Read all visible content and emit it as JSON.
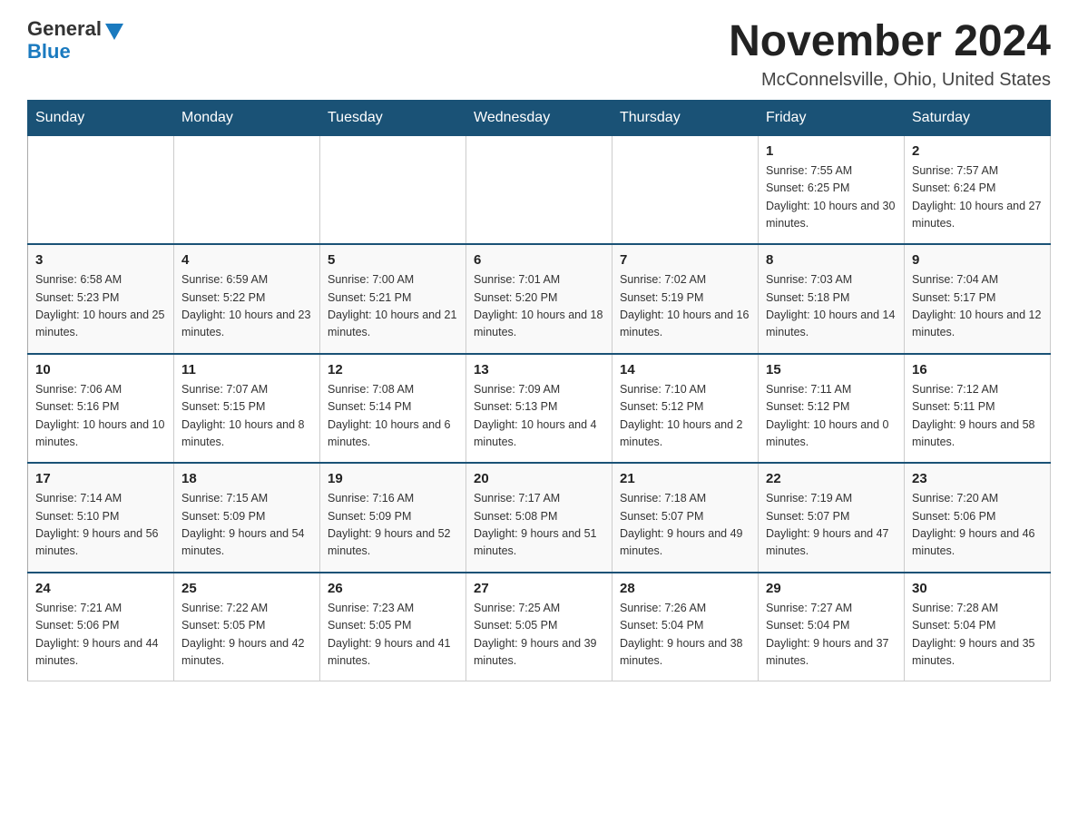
{
  "logo": {
    "general": "General",
    "blue": "Blue"
  },
  "title": "November 2024",
  "location": "McConnelsville, Ohio, United States",
  "headers": [
    "Sunday",
    "Monday",
    "Tuesday",
    "Wednesday",
    "Thursday",
    "Friday",
    "Saturday"
  ],
  "weeks": [
    [
      {
        "day": "",
        "sunrise": "",
        "sunset": "",
        "daylight": ""
      },
      {
        "day": "",
        "sunrise": "",
        "sunset": "",
        "daylight": ""
      },
      {
        "day": "",
        "sunrise": "",
        "sunset": "",
        "daylight": ""
      },
      {
        "day": "",
        "sunrise": "",
        "sunset": "",
        "daylight": ""
      },
      {
        "day": "",
        "sunrise": "",
        "sunset": "",
        "daylight": ""
      },
      {
        "day": "1",
        "sunrise": "Sunrise: 7:55 AM",
        "sunset": "Sunset: 6:25 PM",
        "daylight": "Daylight: 10 hours and 30 minutes."
      },
      {
        "day": "2",
        "sunrise": "Sunrise: 7:57 AM",
        "sunset": "Sunset: 6:24 PM",
        "daylight": "Daylight: 10 hours and 27 minutes."
      }
    ],
    [
      {
        "day": "3",
        "sunrise": "Sunrise: 6:58 AM",
        "sunset": "Sunset: 5:23 PM",
        "daylight": "Daylight: 10 hours and 25 minutes."
      },
      {
        "day": "4",
        "sunrise": "Sunrise: 6:59 AM",
        "sunset": "Sunset: 5:22 PM",
        "daylight": "Daylight: 10 hours and 23 minutes."
      },
      {
        "day": "5",
        "sunrise": "Sunrise: 7:00 AM",
        "sunset": "Sunset: 5:21 PM",
        "daylight": "Daylight: 10 hours and 21 minutes."
      },
      {
        "day": "6",
        "sunrise": "Sunrise: 7:01 AM",
        "sunset": "Sunset: 5:20 PM",
        "daylight": "Daylight: 10 hours and 18 minutes."
      },
      {
        "day": "7",
        "sunrise": "Sunrise: 7:02 AM",
        "sunset": "Sunset: 5:19 PM",
        "daylight": "Daylight: 10 hours and 16 minutes."
      },
      {
        "day": "8",
        "sunrise": "Sunrise: 7:03 AM",
        "sunset": "Sunset: 5:18 PM",
        "daylight": "Daylight: 10 hours and 14 minutes."
      },
      {
        "day": "9",
        "sunrise": "Sunrise: 7:04 AM",
        "sunset": "Sunset: 5:17 PM",
        "daylight": "Daylight: 10 hours and 12 minutes."
      }
    ],
    [
      {
        "day": "10",
        "sunrise": "Sunrise: 7:06 AM",
        "sunset": "Sunset: 5:16 PM",
        "daylight": "Daylight: 10 hours and 10 minutes."
      },
      {
        "day": "11",
        "sunrise": "Sunrise: 7:07 AM",
        "sunset": "Sunset: 5:15 PM",
        "daylight": "Daylight: 10 hours and 8 minutes."
      },
      {
        "day": "12",
        "sunrise": "Sunrise: 7:08 AM",
        "sunset": "Sunset: 5:14 PM",
        "daylight": "Daylight: 10 hours and 6 minutes."
      },
      {
        "day": "13",
        "sunrise": "Sunrise: 7:09 AM",
        "sunset": "Sunset: 5:13 PM",
        "daylight": "Daylight: 10 hours and 4 minutes."
      },
      {
        "day": "14",
        "sunrise": "Sunrise: 7:10 AM",
        "sunset": "Sunset: 5:12 PM",
        "daylight": "Daylight: 10 hours and 2 minutes."
      },
      {
        "day": "15",
        "sunrise": "Sunrise: 7:11 AM",
        "sunset": "Sunset: 5:12 PM",
        "daylight": "Daylight: 10 hours and 0 minutes."
      },
      {
        "day": "16",
        "sunrise": "Sunrise: 7:12 AM",
        "sunset": "Sunset: 5:11 PM",
        "daylight": "Daylight: 9 hours and 58 minutes."
      }
    ],
    [
      {
        "day": "17",
        "sunrise": "Sunrise: 7:14 AM",
        "sunset": "Sunset: 5:10 PM",
        "daylight": "Daylight: 9 hours and 56 minutes."
      },
      {
        "day": "18",
        "sunrise": "Sunrise: 7:15 AM",
        "sunset": "Sunset: 5:09 PM",
        "daylight": "Daylight: 9 hours and 54 minutes."
      },
      {
        "day": "19",
        "sunrise": "Sunrise: 7:16 AM",
        "sunset": "Sunset: 5:09 PM",
        "daylight": "Daylight: 9 hours and 52 minutes."
      },
      {
        "day": "20",
        "sunrise": "Sunrise: 7:17 AM",
        "sunset": "Sunset: 5:08 PM",
        "daylight": "Daylight: 9 hours and 51 minutes."
      },
      {
        "day": "21",
        "sunrise": "Sunrise: 7:18 AM",
        "sunset": "Sunset: 5:07 PM",
        "daylight": "Daylight: 9 hours and 49 minutes."
      },
      {
        "day": "22",
        "sunrise": "Sunrise: 7:19 AM",
        "sunset": "Sunset: 5:07 PM",
        "daylight": "Daylight: 9 hours and 47 minutes."
      },
      {
        "day": "23",
        "sunrise": "Sunrise: 7:20 AM",
        "sunset": "Sunset: 5:06 PM",
        "daylight": "Daylight: 9 hours and 46 minutes."
      }
    ],
    [
      {
        "day": "24",
        "sunrise": "Sunrise: 7:21 AM",
        "sunset": "Sunset: 5:06 PM",
        "daylight": "Daylight: 9 hours and 44 minutes."
      },
      {
        "day": "25",
        "sunrise": "Sunrise: 7:22 AM",
        "sunset": "Sunset: 5:05 PM",
        "daylight": "Daylight: 9 hours and 42 minutes."
      },
      {
        "day": "26",
        "sunrise": "Sunrise: 7:23 AM",
        "sunset": "Sunset: 5:05 PM",
        "daylight": "Daylight: 9 hours and 41 minutes."
      },
      {
        "day": "27",
        "sunrise": "Sunrise: 7:25 AM",
        "sunset": "Sunset: 5:05 PM",
        "daylight": "Daylight: 9 hours and 39 minutes."
      },
      {
        "day": "28",
        "sunrise": "Sunrise: 7:26 AM",
        "sunset": "Sunset: 5:04 PM",
        "daylight": "Daylight: 9 hours and 38 minutes."
      },
      {
        "day": "29",
        "sunrise": "Sunrise: 7:27 AM",
        "sunset": "Sunset: 5:04 PM",
        "daylight": "Daylight: 9 hours and 37 minutes."
      },
      {
        "day": "30",
        "sunrise": "Sunrise: 7:28 AM",
        "sunset": "Sunset: 5:04 PM",
        "daylight": "Daylight: 9 hours and 35 minutes."
      }
    ]
  ]
}
